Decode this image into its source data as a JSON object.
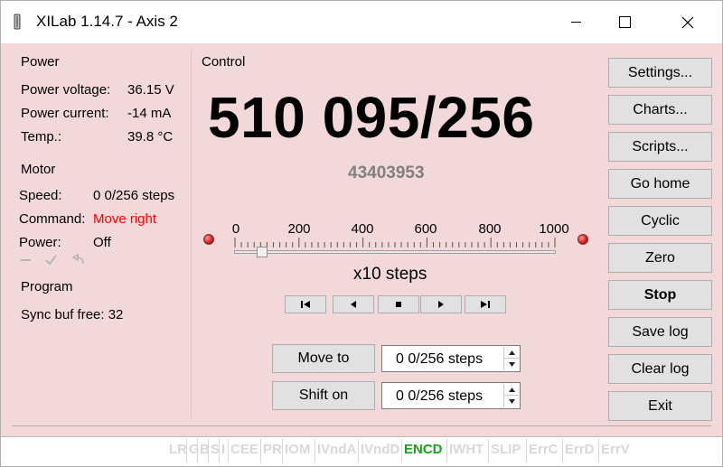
{
  "window": {
    "title": "XILab 1.14.7 - Axis 2"
  },
  "power": {
    "title": "Power",
    "voltage_label": "Power voltage:",
    "voltage_value": "36.15 V",
    "current_label": "Power current:",
    "current_value": "-14 mA",
    "temp_label": "Temp.:",
    "temp_value": "39.8 °C"
  },
  "motor": {
    "title": "Motor",
    "speed_label": "Speed:",
    "speed_value": "0 0/256 steps",
    "command_label": "Command:",
    "command_value": "Move right",
    "command_color": "#ff0000",
    "power_label": "Power:",
    "power_value": "Off"
  },
  "program": {
    "title": "Program",
    "sync_label": "Sync buf free: 32"
  },
  "control": {
    "title": "Control",
    "position": "510 095/256",
    "encoder": "43403953",
    "scale": [
      "0",
      "200",
      "400",
      "600",
      "800",
      "1000"
    ],
    "slider_level": 0.07,
    "multiplier": "x10  steps",
    "move_to_label": "Move to",
    "move_to_value": "0 0/256 steps",
    "shift_on_label": "Shift on",
    "shift_on_value": "0 0/256 steps"
  },
  "side_buttons": [
    "Settings...",
    "Charts...",
    "Scripts...",
    "Go home",
    "Cyclic",
    "Zero",
    "Stop",
    "Save log",
    "Clear log",
    "Exit"
  ],
  "status_flags": [
    {
      "text": "LR",
      "active": false
    },
    {
      "text": "G",
      "active": false
    },
    {
      "text": "B",
      "active": false
    },
    {
      "text": "S",
      "active": false
    },
    {
      "text": "I",
      "active": false
    },
    {
      "text": "CEE",
      "active": false
    },
    {
      "text": "PR",
      "active": false
    },
    {
      "text": "IOM",
      "active": false
    },
    {
      "text": "IVndA",
      "active": false
    },
    {
      "text": "IVndD",
      "active": false
    },
    {
      "text": "ENCD",
      "active": true
    },
    {
      "text": "IWHT",
      "active": false
    },
    {
      "text": "SLIP",
      "active": false
    },
    {
      "text": "ErrC",
      "active": false
    },
    {
      "text": "ErrD",
      "active": false
    },
    {
      "text": "ErrV",
      "active": false
    }
  ],
  "colors": {
    "accent_active": "#1aa01a",
    "background": "#f2d8d9"
  }
}
